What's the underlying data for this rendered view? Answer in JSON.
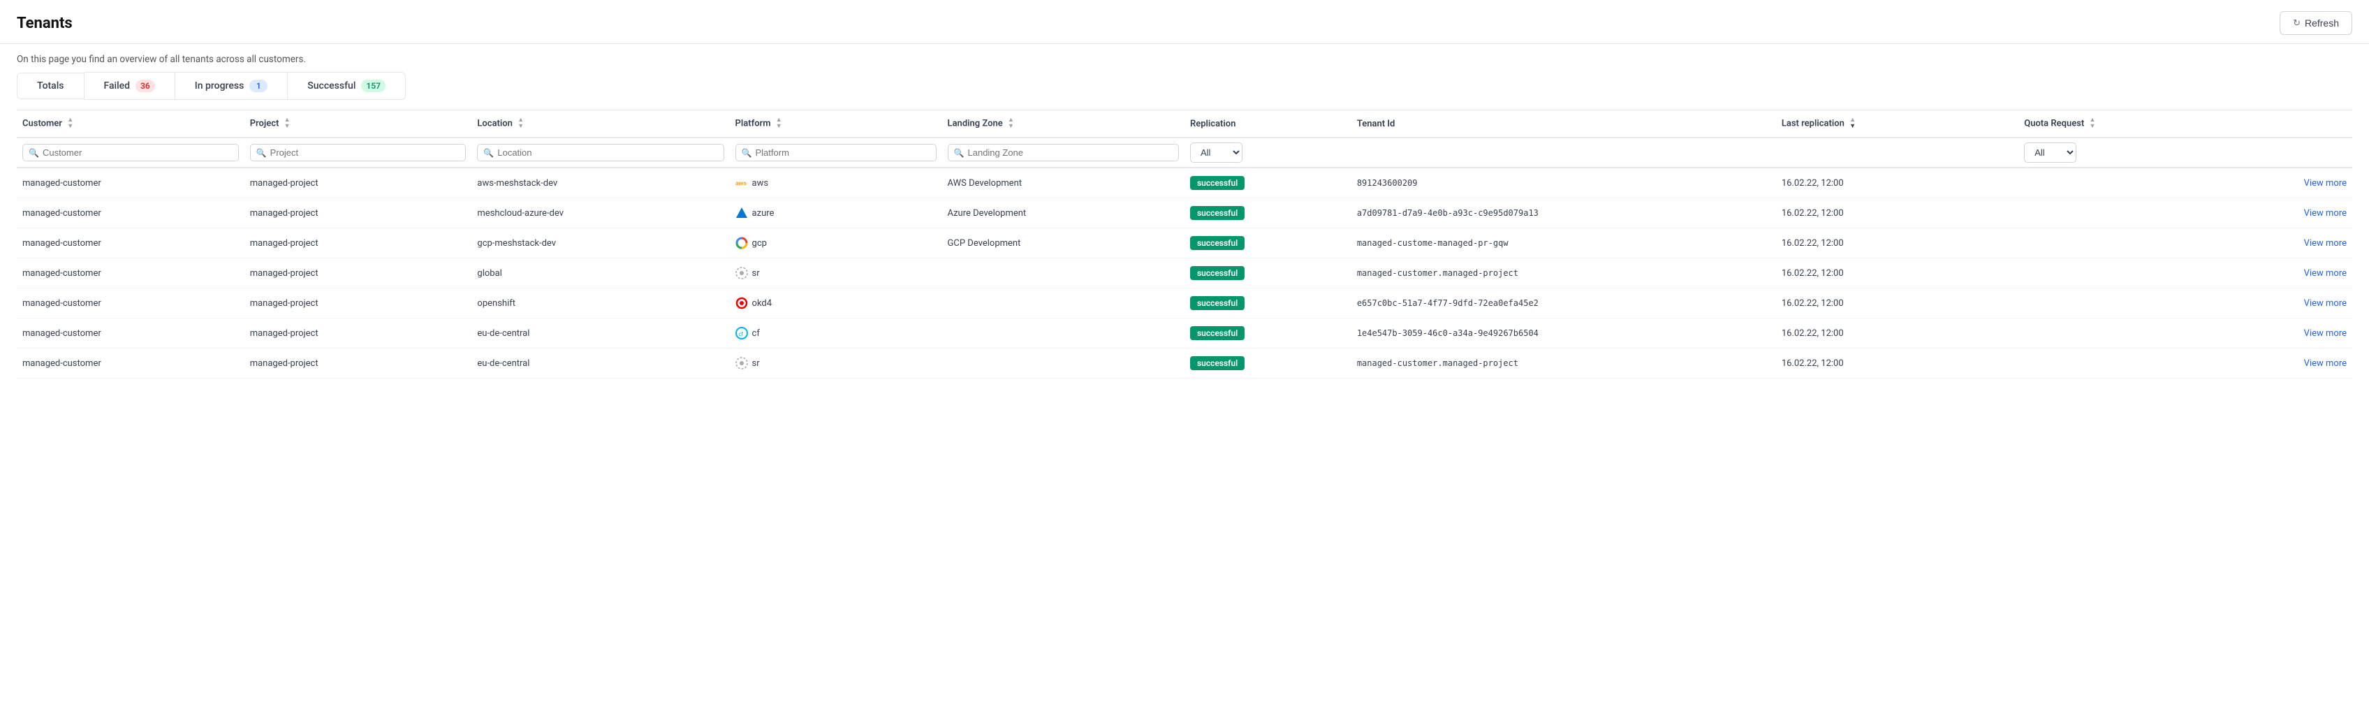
{
  "page": {
    "title": "Tenants",
    "subtitle": "On this page you find an overview of all tenants across all customers."
  },
  "refresh_button": "Refresh",
  "stats": {
    "totals_label": "Totals",
    "failed_label": "Failed",
    "failed_count": "36",
    "inprogress_label": "In progress",
    "inprogress_count": "1",
    "successful_label": "Successful",
    "successful_count": "157"
  },
  "table": {
    "columns": [
      {
        "key": "customer",
        "label": "Customer",
        "sortable": true
      },
      {
        "key": "project",
        "label": "Project",
        "sortable": true
      },
      {
        "key": "location",
        "label": "Location",
        "sortable": true
      },
      {
        "key": "platform",
        "label": "Platform",
        "sortable": true
      },
      {
        "key": "landingzone",
        "label": "Landing Zone",
        "sortable": true
      },
      {
        "key": "replication",
        "label": "Replication",
        "sortable": false
      },
      {
        "key": "tenantid",
        "label": "Tenant Id",
        "sortable": false
      },
      {
        "key": "lastrep",
        "label": "Last replication",
        "sortable": true,
        "sort_dir": "desc"
      },
      {
        "key": "quota",
        "label": "Quota Request",
        "sortable": true
      },
      {
        "key": "action",
        "label": "",
        "sortable": false
      }
    ],
    "filters": {
      "customer_placeholder": "Customer",
      "project_placeholder": "Project",
      "location_placeholder": "Location",
      "platform_placeholder": "Platform",
      "landingzone_placeholder": "Landing Zone",
      "replication_options": [
        "All"
      ],
      "quota_options": [
        "All"
      ]
    },
    "rows": [
      {
        "customer": "managed-customer",
        "project": "managed-project",
        "location": "aws-meshstack-dev",
        "platform_icon": "aws",
        "platform_label": "aws",
        "landingzone": "AWS Development",
        "replication": "successful",
        "tenantid": "891243600209",
        "lastrep": "16.02.22, 12:00",
        "quota": "",
        "action": "View more"
      },
      {
        "customer": "managed-customer",
        "project": "managed-project",
        "location": "meshcloud-azure-dev",
        "platform_icon": "azure",
        "platform_label": "azure",
        "landingzone": "Azure Development",
        "replication": "successful",
        "tenantid": "a7d09781-d7a9-4e0b-a93c-c9e95d079a13",
        "lastrep": "16.02.22, 12:00",
        "quota": "",
        "action": "View more"
      },
      {
        "customer": "managed-customer",
        "project": "managed-project",
        "location": "gcp-meshstack-dev",
        "platform_icon": "gcp",
        "platform_label": "gcp",
        "landingzone": "GCP Development",
        "replication": "successful",
        "tenantid": "managed-custome-managed-pr-gqw",
        "lastrep": "16.02.22, 12:00",
        "quota": "",
        "action": "View more"
      },
      {
        "customer": "managed-customer",
        "project": "managed-project",
        "location": "global",
        "platform_icon": "sr",
        "platform_label": "sr",
        "landingzone": "",
        "replication": "successful",
        "tenantid": "managed-customer.managed-project",
        "lastrep": "16.02.22, 12:00",
        "quota": "",
        "action": "View more"
      },
      {
        "customer": "managed-customer",
        "project": "managed-project",
        "location": "openshift",
        "platform_icon": "okd4",
        "platform_label": "okd4",
        "landingzone": "",
        "replication": "successful",
        "tenantid": "e657c0bc-51a7-4f77-9dfd-72ea0efa45e2",
        "lastrep": "16.02.22, 12:00",
        "quota": "",
        "action": "View more"
      },
      {
        "customer": "managed-customer",
        "project": "managed-project",
        "location": "eu-de-central",
        "platform_icon": "cf",
        "platform_label": "cf",
        "landingzone": "",
        "replication": "successful",
        "tenantid": "1e4e547b-3059-46c0-a34a-9e49267b6504",
        "lastrep": "16.02.22, 12:00",
        "quota": "",
        "action": "View more"
      },
      {
        "customer": "managed-customer",
        "project": "managed-project",
        "location": "eu-de-central",
        "platform_icon": "sr",
        "platform_label": "sr",
        "landingzone": "",
        "replication": "successful",
        "tenantid": "managed-customer.managed-project",
        "lastrep": "16.02.22, 12:00",
        "quota": "",
        "action": "View more"
      }
    ]
  }
}
